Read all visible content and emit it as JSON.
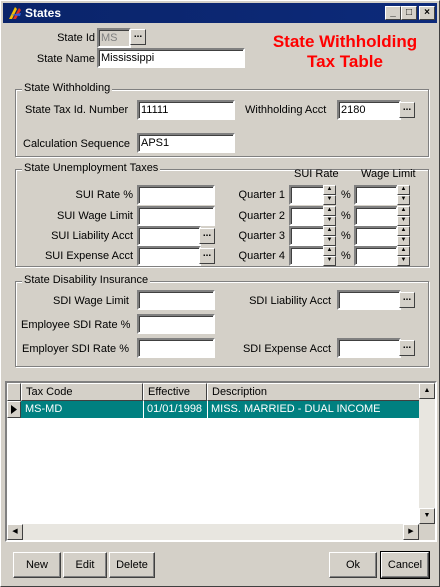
{
  "window": {
    "title": "States"
  },
  "header": {
    "line1": "State Withholding",
    "line2": "Tax Table"
  },
  "state": {
    "id_label": "State Id",
    "id_value": "MS",
    "name_label": "State Name",
    "name_value": "Mississippi"
  },
  "withholding": {
    "group_title": "State Withholding",
    "tax_id_label": "State Tax Id. Number",
    "tax_id_value": "11111",
    "acct_label": "Withholding  Acct",
    "acct_value": "2180",
    "calc_seq_label": "Calculation Sequence",
    "calc_seq_value": "APS1"
  },
  "unemployment": {
    "group_title": "State Unemployment Taxes",
    "sui_rate_label": "SUI Rate %",
    "sui_wage_limit_label": "SUI Wage Limit",
    "sui_liability_label": "SUI Liability Acct",
    "sui_expense_label": "SUI Expense Acct",
    "col_sui_rate": "SUI Rate",
    "col_wage_limit": "Wage Limit",
    "pct": "%",
    "quarters": [
      "Quarter 1",
      "Quarter 2",
      "Quarter 3",
      "Quarter 4"
    ]
  },
  "disability": {
    "group_title": "State Disability Insurance",
    "sdi_wage_limit_label": "SDI Wage Limit",
    "employee_rate_label": "Employee SDI Rate %",
    "employer_rate_label": "Employer SDI Rate %",
    "sdi_liability_label": "SDI Liability Acct",
    "sdi_expense_label": "SDI Expense Acct"
  },
  "grid": {
    "columns": [
      "Tax Code",
      "Effective",
      "Description"
    ],
    "rows": [
      {
        "tax_code": "MS-MD",
        "effective": "01/01/1998",
        "description": "MISS. MARRIED - DUAL INCOME"
      }
    ]
  },
  "buttons": {
    "new": "New",
    "edit": "Edit",
    "delete": "Delete",
    "ok": "Ok",
    "cancel": "Cancel"
  },
  "icons": {
    "ellipsis": "...",
    "minimize": "_",
    "maximize": "□",
    "close": "×"
  }
}
